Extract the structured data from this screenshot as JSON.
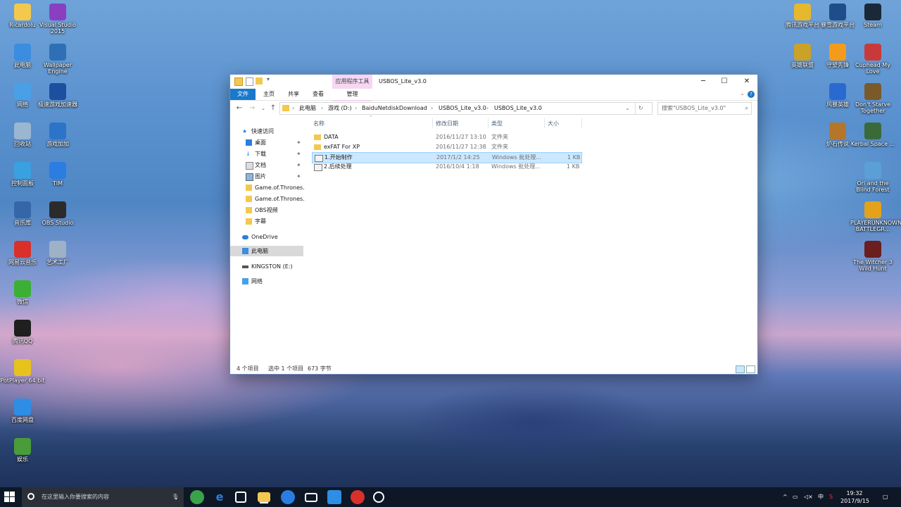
{
  "desktop_left": [
    {
      "label": "Ricardolu",
      "color": "#f2c94c"
    },
    {
      "label": "Visual Studio 2015",
      "color": "#8a3fc1"
    },
    {
      "label": "此电脑",
      "color": "#3a8de0"
    },
    {
      "label": "Wallpaper Engine",
      "color": "#2f6fb5"
    },
    {
      "label": "网络",
      "color": "#4aa0e6"
    },
    {
      "label": "极速游戏加速器",
      "color": "#1c4fa0"
    },
    {
      "label": "回收站",
      "color": "#9bb6d1"
    },
    {
      "label": "游戏加加",
      "color": "#2c74c8"
    },
    {
      "label": "控制面板",
      "color": "#3aa1e0"
    },
    {
      "label": "TIM",
      "color": "#2a7de1"
    },
    {
      "label": "音乐库",
      "color": "#3566a8"
    },
    {
      "label": "OBS Studio",
      "color": "#2b2b2b"
    },
    {
      "label": "网易云音乐",
      "color": "#d9302a"
    },
    {
      "label": "艺术工厂",
      "color": "#9fb1c5"
    },
    {
      "label": "微信",
      "color": "#3cb034"
    },
    {
      "label": "腾讯QQ",
      "color": "#1f1f1f"
    },
    {
      "label": "PotPlayer 64 bit",
      "color": "#e8c21c"
    },
    {
      "label": "百度网盘",
      "color": "#2e8ee5"
    },
    {
      "label": "娱乐",
      "color": "#4a9b3a"
    }
  ],
  "desktop_right": [
    {
      "label": "腾讯游戏平台",
      "color": "#e6b82e"
    },
    {
      "label": "暴雪游戏平台",
      "color": "#1e4d8a"
    },
    {
      "label": "Steam",
      "color": "#1b2838"
    },
    {
      "label": "英雄联盟",
      "color": "#c9a227"
    },
    {
      "label": "守望先锋",
      "color": "#f49b1c"
    },
    {
      "label": "Cuphead My Love",
      "color": "#c83a3a"
    },
    {
      "label": "风暴英雄",
      "color": "#2a6ad0"
    },
    {
      "label": "Don't Starve Together",
      "color": "#7a5a2a"
    },
    {
      "label": "炉石传说",
      "color": "#b5762a"
    },
    {
      "label": "Kerbal Space ...",
      "color": "#3a6a3a"
    },
    {
      "label": "Ori and the Blind Forest",
      "color": "#5b9fd8"
    },
    {
      "label": "PLAYERUNKNOWN'S BATTLEGR...",
      "color": "#e3a21a"
    },
    {
      "label": "The Witcher 3 Wild Hunt",
      "color": "#6a1e1e"
    }
  ],
  "window": {
    "contextual_tab": "应用程序工具",
    "title": "USBOS_Lite_v3.0",
    "ribbon_tabs": {
      "file": "文件",
      "home": "主页",
      "share": "共享",
      "view": "查看",
      "manage": "管理"
    },
    "breadcrumb": [
      "此电脑",
      "游戏 (D:)",
      "BaiduNetdiskDownload",
      "USBOS_Lite_v3.0",
      "USBOS_Lite_v3.0"
    ],
    "search_placeholder": "搜索\"USBOS_Lite_v3.0\"",
    "nav": {
      "quick_access": "快速访问",
      "desktop": "桌面",
      "downloads": "下载",
      "documents": "文档",
      "pictures": "图片",
      "got1": "Game.of.Thrones.",
      "got2": "Game.of.Thrones.",
      "obs": "OBS视频",
      "subtitles": "字幕",
      "onedrive": "OneDrive",
      "this_pc": "此电脑",
      "kingston": "KINGSTON (E:)",
      "network": "网络"
    },
    "columns": {
      "name": "名称",
      "modified": "修改日期",
      "type": "类型",
      "size": "大小"
    },
    "files": [
      {
        "name": "DATA",
        "modified": "2016/11/27 13:10",
        "type": "文件夹",
        "size": "",
        "kind": "folder"
      },
      {
        "name": "exFAT For XP",
        "modified": "2016/11/27 12:38",
        "type": "文件夹",
        "size": "",
        "kind": "folder"
      },
      {
        "name": "1.开始制作",
        "modified": "2017/1/2 14:25",
        "type": "Windows 批处理...",
        "size": "1 KB",
        "kind": "bat",
        "selected": true
      },
      {
        "name": "2.后续处理",
        "modified": "2016/10/4 1:18",
        "type": "Windows 批处理...",
        "size": "1 KB",
        "kind": "bat"
      }
    ],
    "status": {
      "count": "4 个项目",
      "selected": "选中 1 个项目",
      "size": "673 字节"
    }
  },
  "taskbar": {
    "search_placeholder": "在这里输入你要搜索的内容",
    "time": "19:32",
    "date": "2017/9/15",
    "ime": "中"
  }
}
